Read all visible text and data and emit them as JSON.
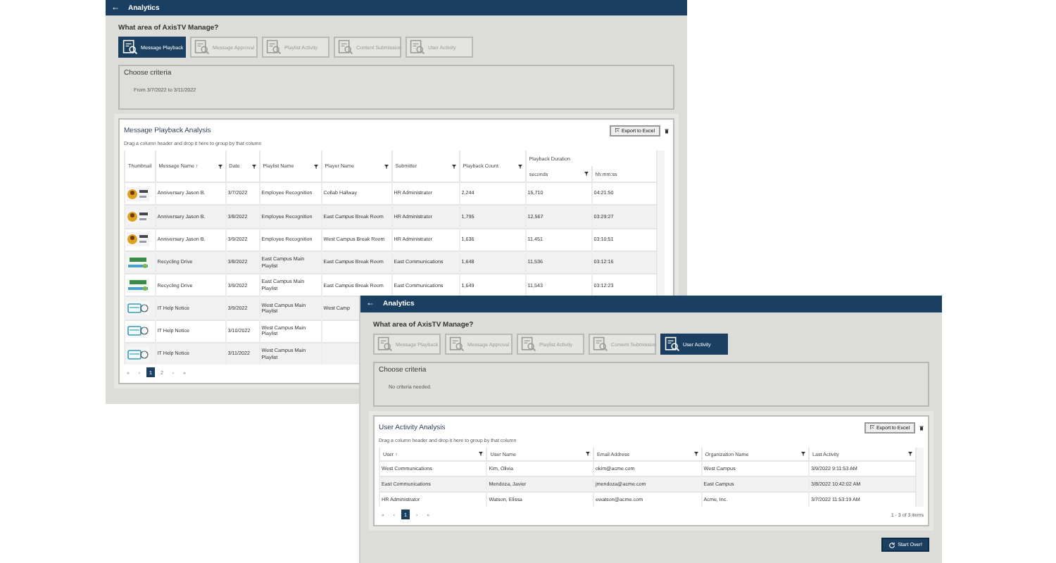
{
  "windows": [
    {
      "title": "Analytics",
      "back_arrow": "←",
      "question": "What area of AxisTV Manage?",
      "areas": [
        {
          "label": "Message Playback",
          "selected": true
        },
        {
          "label": "Message Approval",
          "selected": false
        },
        {
          "label": "Playlist Activity",
          "selected": false
        },
        {
          "label": "Content Submission",
          "selected": false
        },
        {
          "label": "User Activity",
          "selected": false
        }
      ],
      "criteria": {
        "title": "Choose criteria",
        "text": "From 3/7/2022 to 3/11/2022"
      },
      "panel": {
        "title": "Message Playback Analysis",
        "export": "Export to Excel",
        "hint": "Drag a column header and drop it here to group by that column",
        "columns": [
          {
            "label": "Thumbnail",
            "kind": "thumbnail",
            "filter": false
          },
          {
            "label": "Message Name ↑",
            "kind": "text",
            "filter": true
          },
          {
            "label": "Date",
            "kind": "text",
            "filter": true
          },
          {
            "label": "Playlist Name",
            "kind": "text",
            "filter": true
          },
          {
            "label": "Player Name",
            "kind": "text",
            "filter": true
          },
          {
            "label": "Submitter",
            "kind": "text",
            "filter": true
          },
          {
            "label": "Playback Count",
            "kind": "text",
            "filter": true
          }
        ],
        "group": {
          "label": "Playback Duration",
          "columns": [
            {
              "label": "seconds",
              "filter": true
            },
            {
              "label": "hh:mm:ss",
              "filter": false
            }
          ]
        },
        "rows": [
          {
            "cells": [
              "",
              "Anniversary Jason B.",
              "3/7/2022",
              "Employee Recognition",
              "Collab Hallway",
              "HR Administrator",
              "2,244",
              "15,710",
              "04:21:50"
            ]
          },
          {
            "cells": [
              "",
              "Anniversary Jason B.",
              "3/8/2022",
              "Employee Recognition",
              "East Campus Break Room",
              "HR Administrator",
              "1,795",
              "12,567",
              "03:29:27"
            ]
          },
          {
            "cells": [
              "",
              "Anniversary Jason B.",
              "3/9/2022",
              "Employee Recognition",
              "West Campus Break Room",
              "HR Administrator",
              "1,636",
              "11,451",
              "03:10:51"
            ]
          },
          {
            "cells": [
              "",
              "Recycling Drive",
              "3/8/2022",
              "East Campus Main Playlist",
              "East Campus Break Room",
              "East Communications",
              "1,648",
              "11,536",
              "03:12:16"
            ]
          },
          {
            "cells": [
              "",
              "Recycling Drive",
              "3/9/2022",
              "East Campus Main Playlist",
              "East Campus Break Room",
              "East Communications",
              "1,649",
              "11,543",
              "03:12:23"
            ]
          },
          {
            "cells": [
              "",
              "IT Help Notice",
              "3/9/2022",
              "West Campus Main Playlist",
              "West Camp"
            ]
          },
          {
            "cells": [
              "",
              "IT Help Notice",
              "3/10/2022",
              "West Campus Main Playlist"
            ]
          },
          {
            "cells": [
              "",
              "IT Help Notice",
              "3/11/2022",
              "West Campus Main Playlist"
            ]
          }
        ],
        "pager": [
          {
            "label": "«",
            "selected": false
          },
          {
            "label": "‹",
            "selected": false
          },
          {
            "label": "1",
            "selected": true
          },
          {
            "label": "2",
            "selected": false
          },
          {
            "label": "›",
            "selected": false
          },
          {
            "label": "»",
            "selected": false
          }
        ]
      }
    },
    {
      "title": "Analytics",
      "back_arrow": "←",
      "question": "What area of AxisTV Manage?",
      "areas": [
        {
          "label": "Message Playback",
          "selected": false
        },
        {
          "label": "Message Approval",
          "selected": false
        },
        {
          "label": "Playlist Activity",
          "selected": false
        },
        {
          "label": "Content Submission",
          "selected": false
        },
        {
          "label": "User Activity",
          "selected": true
        }
      ],
      "criteria": {
        "title": "Choose criteria",
        "text": "No criteria needed."
      },
      "panel": {
        "title": "User Activity Analysis",
        "export": "Export to Excel",
        "hint": "Drag a column header and drop it here to group by that column",
        "columns": [
          {
            "label": "User ↑",
            "kind": "text",
            "filter": true
          },
          {
            "label": "User Name",
            "kind": "text",
            "filter": true
          },
          {
            "label": "Email Address",
            "kind": "text",
            "filter": true
          },
          {
            "label": "Organization Name",
            "kind": "text",
            "filter": true
          },
          {
            "label": "Last Activity",
            "kind": "text",
            "filter": true
          }
        ],
        "rows": [
          {
            "cells": [
              "West Communications",
              "Kim, Olivia",
              "okim@acme.com",
              "West Campus",
              "3/9/2022 9:11:53 AM"
            ]
          },
          {
            "cells": [
              "East Communications",
              "Mendoza, Javier",
              "jmendoza@acme.com",
              "East Campus",
              "3/8/2022 10:42:02 AM"
            ]
          },
          {
            "cells": [
              "HR Administrator",
              "Watson, Elissa",
              "ewatson@acme.com",
              "Acme, Inc.",
              "3/7/2022 11:53:19 AM"
            ]
          }
        ],
        "pager": [
          {
            "label": "«",
            "selected": false
          },
          {
            "label": "‹",
            "selected": false
          },
          {
            "label": "1",
            "selected": true
          },
          {
            "label": "›",
            "selected": false
          },
          {
            "label": "»",
            "selected": false
          }
        ],
        "count": "1 - 3 of 3 items"
      },
      "start_over": "Start Over!"
    }
  ]
}
